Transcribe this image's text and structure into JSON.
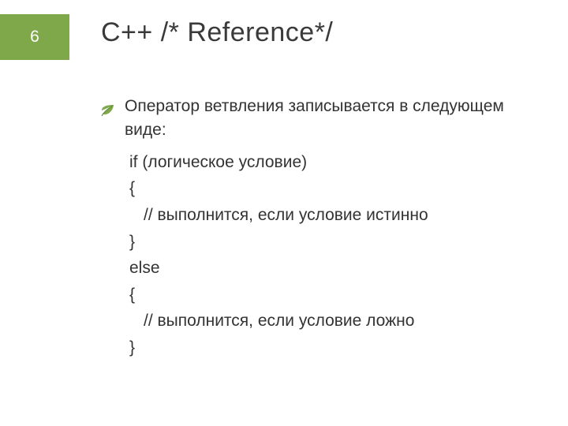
{
  "page_number": "6",
  "title": "С++ /* Reference*/",
  "bullet_text": "Оператор ветвления записывается в следующем виде:",
  "code": {
    "l1": "if (логическое условие)",
    "l2": "{",
    "l3": "// выполнится, если условие истинно",
    "l4": "}",
    "l5": "else",
    "l6": "{",
    "l7": "// выполнится, если условие ложно",
    "l8": "}"
  },
  "colors": {
    "accent": "#7fa84b"
  }
}
